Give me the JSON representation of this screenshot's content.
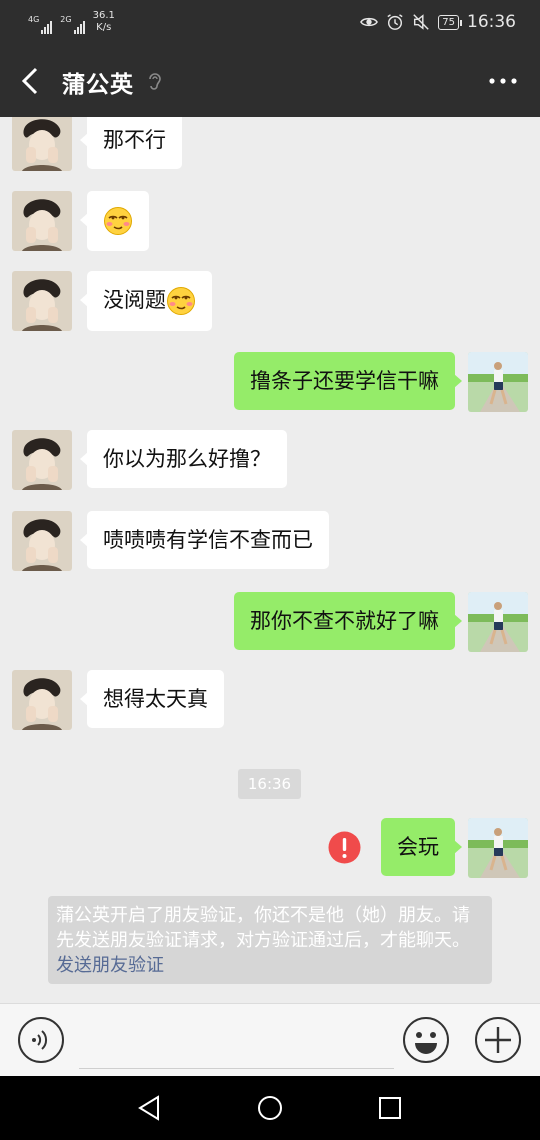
{
  "status_bar": {
    "network1": "4G",
    "network2": "2G",
    "speed_value": "36.1",
    "speed_unit": "K/s",
    "battery": "75",
    "time": "16:36",
    "icons": [
      "eye-icon",
      "alarm-icon",
      "mute-icon",
      "battery-icon"
    ]
  },
  "header": {
    "title": "蒲公英",
    "back_icon": "chevron-left-icon",
    "mode_icon": "ear-icon",
    "more_icon": "more-dots-icon"
  },
  "messages": [
    {
      "side": "left",
      "text": "那不行"
    },
    {
      "side": "left",
      "text": "",
      "emoji": "smirk-emoji"
    },
    {
      "side": "left",
      "text": "没阅题",
      "emoji": "smirk-emoji"
    },
    {
      "side": "right",
      "text": "撸条子还要学信干嘛"
    },
    {
      "side": "left",
      "text": "你以为那么好撸？"
    },
    {
      "side": "left",
      "text": "啧啧啧有学信不查而已"
    },
    {
      "side": "right",
      "text": "那你不查不就好了嘛"
    },
    {
      "side": "left",
      "text": "想得太天真"
    },
    {
      "side": "right",
      "text": "会玩",
      "failed": true
    }
  ],
  "timestamp": "16:36",
  "system_notice": {
    "text": "蒲公英开启了朋友验证，你还不是他（她）朋友。请先发送朋友验证请求，对方验证通过后，才能聊天。",
    "link": "发送朋友验证"
  },
  "input_bar": {
    "voice_icon": "voice-icon",
    "emoji_icon": "emoji-icon",
    "plus_icon": "plus-icon",
    "value": ""
  },
  "nav_bar": {
    "icons": [
      "back-triangle-icon",
      "home-circle-icon",
      "recents-square-icon"
    ]
  },
  "colors": {
    "bar_bg": "#2e2e2e",
    "chat_bg": "#ededed",
    "sent_bubble": "#95ec69",
    "received_bubble": "#ffffff",
    "link": "#576b95",
    "error": "#f04b4b"
  }
}
